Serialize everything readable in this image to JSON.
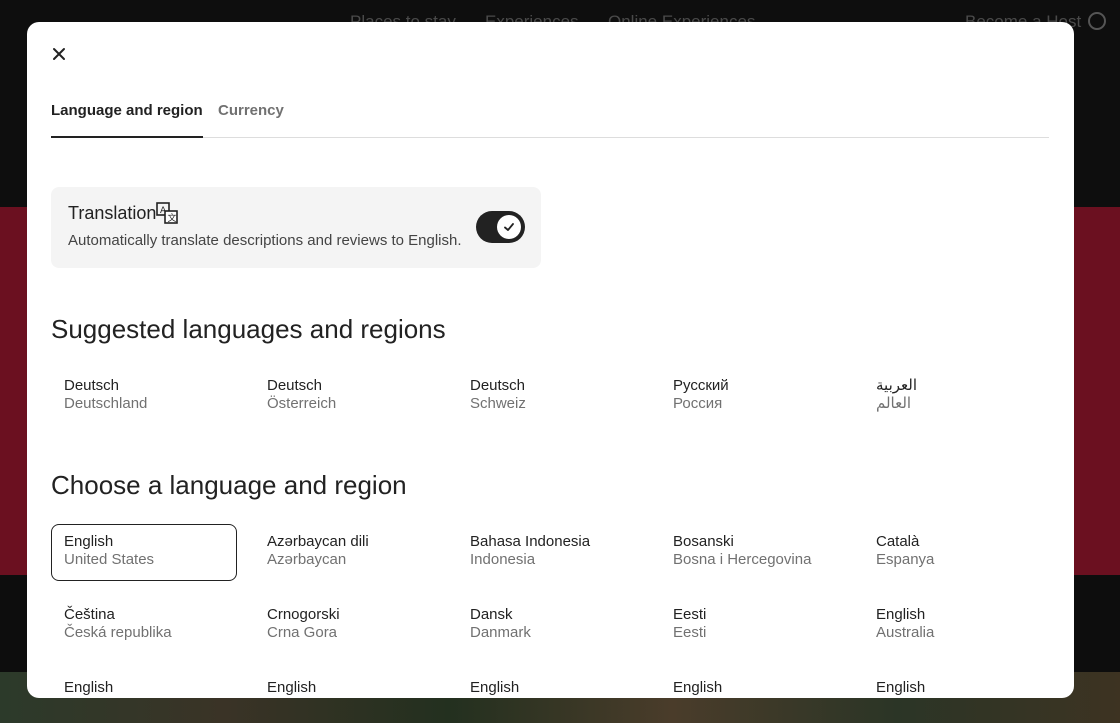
{
  "background": {
    "nav": [
      "Places to stay",
      "Experiences",
      "Online Experiences"
    ],
    "host_link": "Become a Host"
  },
  "modal": {
    "tabs": [
      {
        "label": "Language and region",
        "active": true
      },
      {
        "label": "Currency",
        "active": false
      }
    ],
    "translation": {
      "title": "Translation",
      "description": "Automatically translate descriptions and reviews to English.",
      "enabled": true
    },
    "suggested_title": "Suggested languages and regions",
    "suggested": [
      {
        "language": "Deutsch",
        "region": "Deutschland"
      },
      {
        "language": "Deutsch",
        "region": "Österreich"
      },
      {
        "language": "Deutsch",
        "region": "Schweiz"
      },
      {
        "language": "Русский",
        "region": "Россия"
      },
      {
        "language": "العربية",
        "region": "العالم"
      }
    ],
    "choose_title": "Choose a language and region",
    "languages": [
      {
        "language": "English",
        "region": "United States",
        "selected": true
      },
      {
        "language": "Azərbaycan dili",
        "region": "Azərbaycan"
      },
      {
        "language": "Bahasa Indonesia",
        "region": "Indonesia"
      },
      {
        "language": "Bosanski",
        "region": "Bosna i Hercegovina"
      },
      {
        "language": "Català",
        "region": "Espanya"
      },
      {
        "language": "Čeština",
        "region": "Česká republika"
      },
      {
        "language": "Crnogorski",
        "region": "Crna Gora"
      },
      {
        "language": "Dansk",
        "region": "Danmark"
      },
      {
        "language": "Eesti",
        "region": "Eesti"
      },
      {
        "language": "English",
        "region": "Australia"
      },
      {
        "language": "English",
        "region": ""
      },
      {
        "language": "English",
        "region": ""
      },
      {
        "language": "English",
        "region": ""
      },
      {
        "language": "English",
        "region": ""
      },
      {
        "language": "English",
        "region": ""
      }
    ]
  }
}
